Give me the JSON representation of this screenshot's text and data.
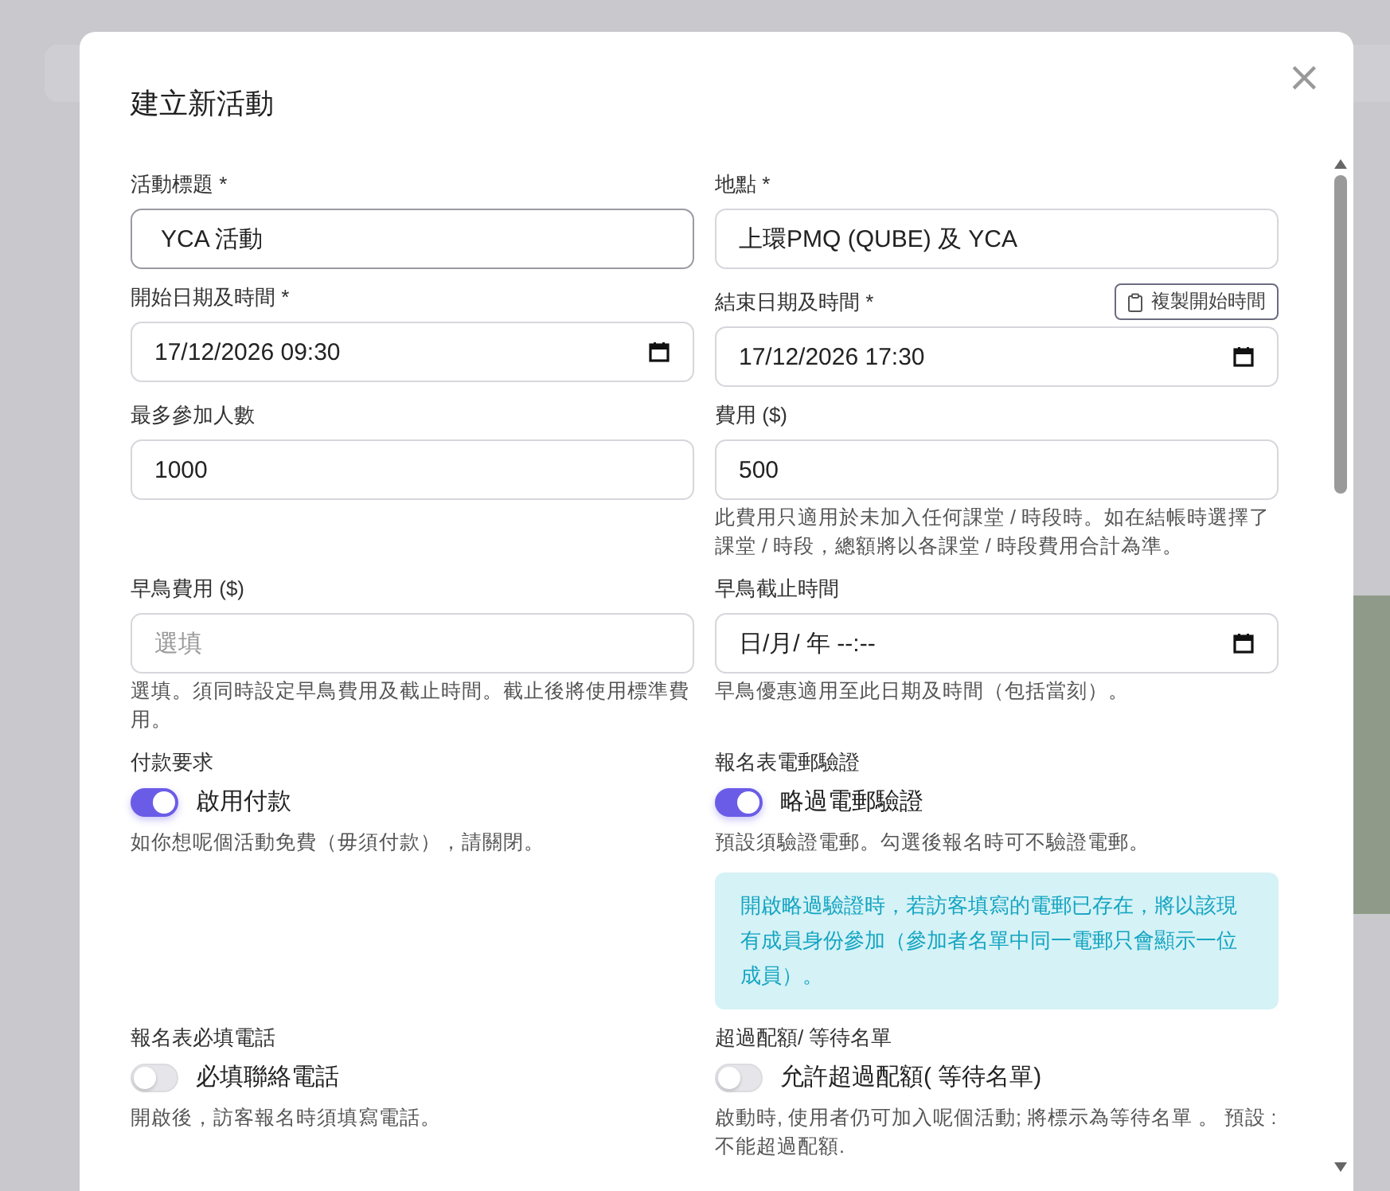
{
  "dialog": {
    "title": "建立新活動",
    "close": "×",
    "fields": [
      {
        "kind": "text",
        "label": "活動標題 *",
        "value": "YCA 活動",
        "focused": true
      },
      {
        "kind": "text",
        "label": "地點 *",
        "value": "上環PMQ (QUBE) 及 YCA",
        "focused": false
      },
      {
        "kind": "datetime",
        "label": "開始日期及時間 *",
        "value": "17/12/2026 09:30"
      },
      {
        "kind": "datetime",
        "label": "結束日期及時間 *",
        "value": "17/12/2026 17:30",
        "action": "複製開始時間"
      },
      {
        "kind": "text",
        "label": "最多參加人數",
        "value": "1000",
        "focused": false
      },
      {
        "kind": "text",
        "label": "費用 ($)",
        "value": "500",
        "focused": false,
        "help": "此費用只適用於未加入任何課堂 / 時段時。如在結帳時選擇了課堂 / 時段，總額將以各課堂 / 時段費用合計為準。"
      },
      {
        "kind": "text",
        "label": "早鳥費用 ($)",
        "placeholder": "選填",
        "focused": false,
        "help": "選填。須同時設定早鳥費用及截止時間。截止後將使用標準費用。"
      },
      {
        "kind": "datetime",
        "label": "早鳥截止時間",
        "value": "日/月/ 年 --:--",
        "help": "早鳥優惠適用至此日期及時間（包括當刻）。"
      },
      {
        "kind": "toggle",
        "label": "付款要求",
        "option": "啟用付款",
        "on": true,
        "help": "如你想呢個活動免費（毋須付款），請關閉。"
      },
      {
        "kind": "toggle",
        "label": "報名表電郵驗證",
        "option": "略過電郵驗證",
        "on": true,
        "help": "預設須驗證電郵。勾選後報名時可不驗證電郵。",
        "notice": "開啟略過驗證時，若訪客填寫的電郵已存在，將以該現有成員身份參加（參加者名單中同一電郵只會顯示一位成員）。"
      },
      {
        "kind": "toggle",
        "label": "報名表必填電話",
        "option": "必填聯絡電話",
        "on": false,
        "help": "開啟後，訪客報名時須填寫電話。"
      },
      {
        "kind": "toggle",
        "label": "超過配額/ 等待名單",
        "option": "允許超過配額( 等待名單)",
        "on": false,
        "help": "啟動時, 使用者仍可加入呢個活動; 將標示為等待名單 。 預設 : 不能超過配額."
      }
    ]
  }
}
